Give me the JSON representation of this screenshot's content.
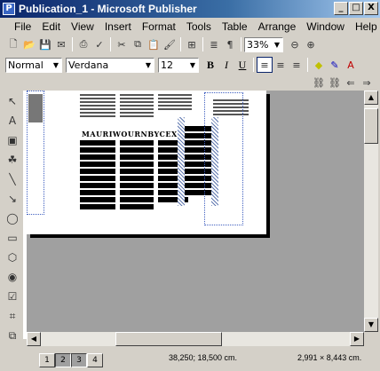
{
  "window": {
    "title": "Publication_1 - Microsoft Publisher",
    "minimize": "_",
    "maximize": "□",
    "close": "X"
  },
  "menu": [
    "File",
    "Edit",
    "View",
    "Insert",
    "Format",
    "Tools",
    "Table",
    "Arrange",
    "Window",
    "Help"
  ],
  "toolbar": {
    "zoom": "33%"
  },
  "format_bar": {
    "style": "Normal",
    "font": "Verdana",
    "size": "12",
    "bold": "B",
    "italic": "I",
    "underline": "U"
  },
  "document": {
    "heading": "MAURIWOURNBYCEX"
  },
  "status": {
    "pages": [
      "1",
      "2",
      "3",
      "4"
    ],
    "active_page": "3",
    "position": "38,250; 18,500 cm.",
    "size": "2,991 × 8,443 cm."
  }
}
